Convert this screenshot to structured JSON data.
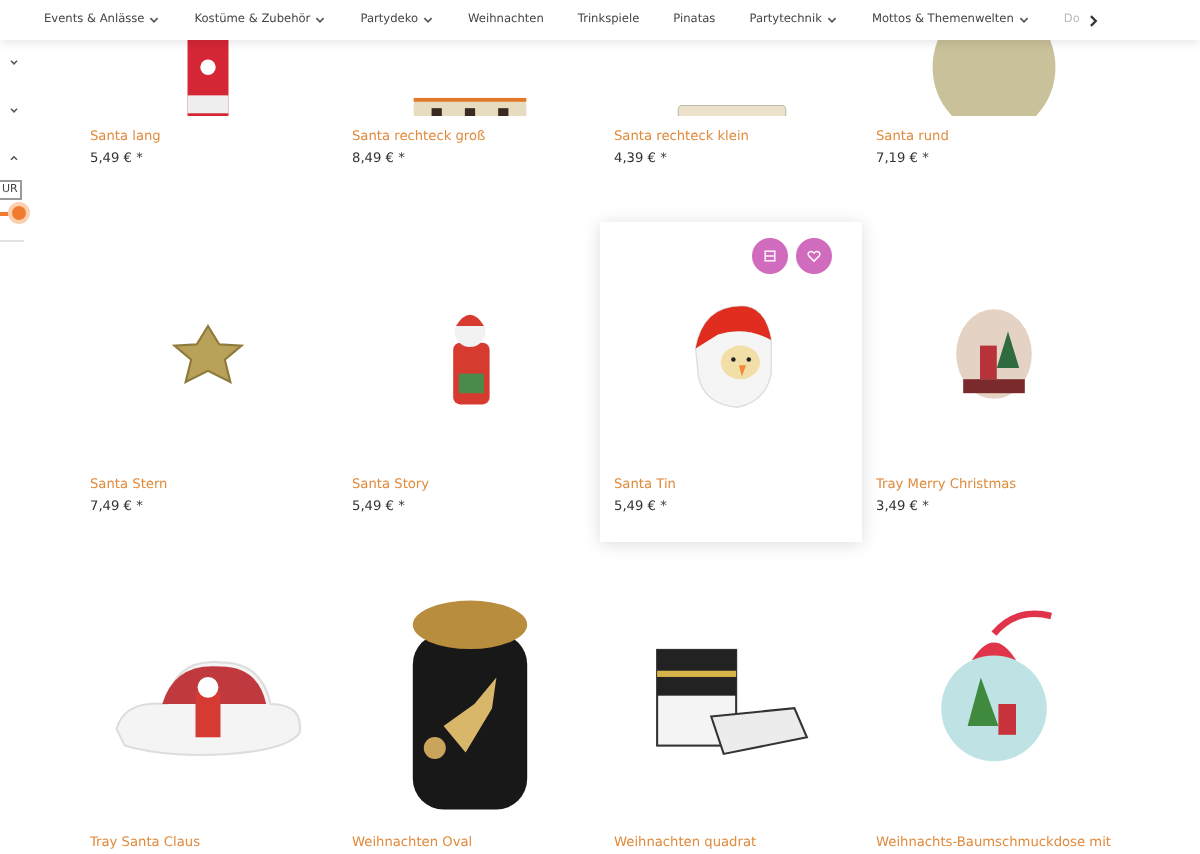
{
  "nav": {
    "items": [
      {
        "label": "Events & Anlässe",
        "has_dropdown": true,
        "dimmed": false
      },
      {
        "label": "Kostüme & Zubehör",
        "has_dropdown": true,
        "dimmed": false
      },
      {
        "label": "Partydeko",
        "has_dropdown": true,
        "dimmed": false
      },
      {
        "label": "Weihnachten",
        "has_dropdown": false,
        "dimmed": false
      },
      {
        "label": "Trinkspiele",
        "has_dropdown": false,
        "dimmed": false
      },
      {
        "label": "Pinatas",
        "has_dropdown": false,
        "dimmed": false
      },
      {
        "label": "Partytechnik",
        "has_dropdown": true,
        "dimmed": false
      },
      {
        "label": "Mottos & Themenwelten",
        "has_dropdown": true,
        "dimmed": false
      },
      {
        "label": "Do",
        "has_dropdown": false,
        "dimmed": true
      }
    ]
  },
  "sidebar": {
    "filters": [
      {
        "expanded": false
      },
      {
        "expanded": false
      },
      {
        "expanded": true
      }
    ],
    "currency_field": {
      "value": "UR"
    },
    "price_slider": {
      "level": 1
    }
  },
  "product_rows": [
    {
      "products": [
        {
          "name": "Santa lang",
          "price": "5,49 € *",
          "kind": "red-tin",
          "hovered": false
        },
        {
          "name": "Santa rechteck groß",
          "price": "8,49 € *",
          "kind": "rect-tin",
          "hovered": false
        },
        {
          "name": "Santa rechteck klein",
          "price": "4,39 € *",
          "kind": "flat-tin",
          "hovered": false
        },
        {
          "name": "Santa rund",
          "price": "7,19 € *",
          "kind": "round-tin",
          "hovered": false
        }
      ]
    },
    {
      "products": [
        {
          "name": "Santa Stern",
          "price": "7,49 € *",
          "kind": "star-tin",
          "hovered": false
        },
        {
          "name": "Santa Story",
          "price": "5,49 € *",
          "kind": "santa-figure",
          "hovered": false
        },
        {
          "name": "Santa Tin",
          "price": "5,49 € *",
          "kind": "santa-head",
          "hovered": true
        },
        {
          "name": "Tray Merry Christmas",
          "price": "3,49 € *",
          "kind": "round-plate",
          "hovered": false
        }
      ]
    },
    {
      "products": [
        {
          "name": "Tray Santa Claus",
          "kind": "cloud-tray",
          "hovered": false
        },
        {
          "name": "Weihnachten Oval",
          "kind": "oval-tin",
          "hovered": false
        },
        {
          "name": "Weihnachten quadrat",
          "kind": "box-set",
          "hovered": false
        },
        {
          "name": "Weihnachts-Baumschmuckdose mit",
          "kind": "ornament",
          "hovered": false
        }
      ]
    }
  ]
}
